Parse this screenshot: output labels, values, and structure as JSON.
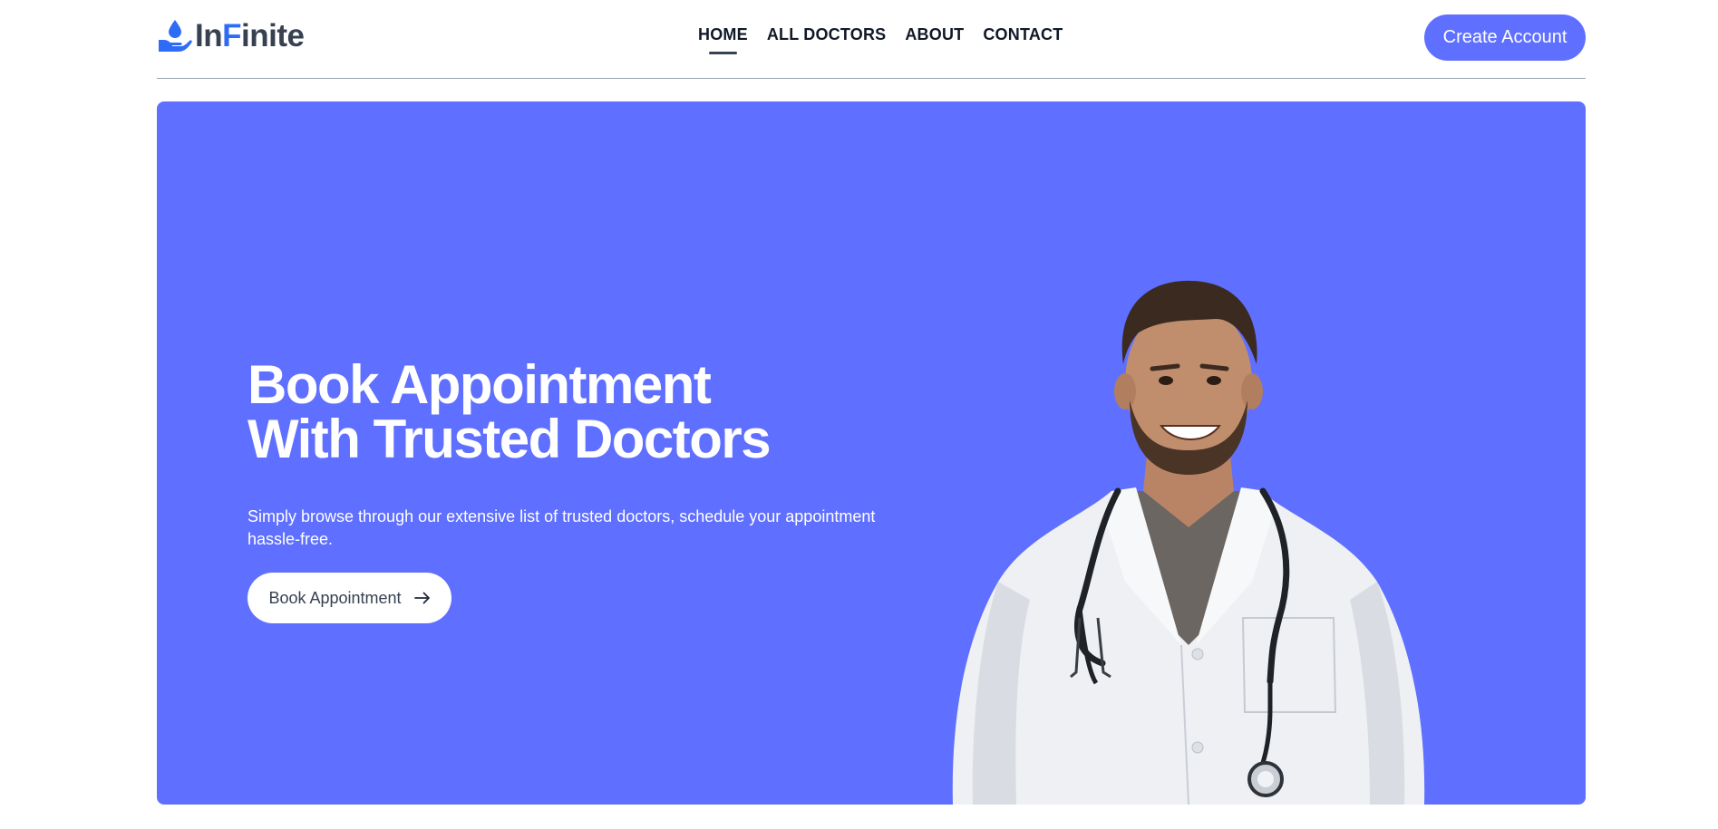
{
  "brand": {
    "name_part1": "In",
    "name_part2": "F",
    "name_part3": "inite",
    "accent_color": "#2f6cf6",
    "icon": "drop-in-hand-icon"
  },
  "nav": {
    "items": [
      {
        "label": "HOME",
        "active": true
      },
      {
        "label": "ALL DOCTORS",
        "active": false
      },
      {
        "label": "ABOUT",
        "active": false
      },
      {
        "label": "CONTACT",
        "active": false
      }
    ],
    "cta_label": "Create Account"
  },
  "hero": {
    "title_line1": "Book Appointment",
    "title_line2": "With Trusted Doctors",
    "description": "Simply browse through our extensive list of trusted doctors, schedule your appointment hassle-free.",
    "button_label": "Book Appointment",
    "button_icon": "arrow-right-icon",
    "background_color": "#5f6fff",
    "image": "smiling-doctor-with-stethoscope"
  }
}
